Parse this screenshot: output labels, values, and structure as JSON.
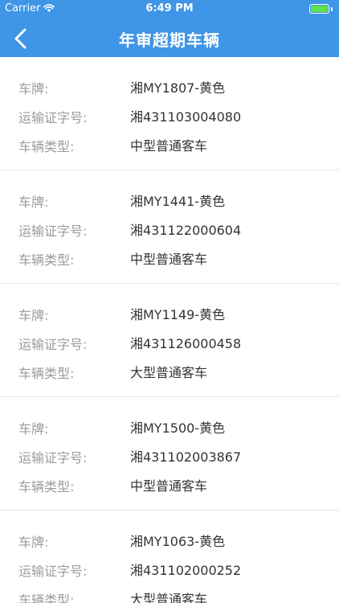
{
  "status_bar": {
    "carrier": "Carrier",
    "time": "6:49 PM",
    "battery_level_percent": 100
  },
  "nav": {
    "back_icon": "chevron-left-icon",
    "title": "年审超期车辆"
  },
  "labels": {
    "plate": "车牌:",
    "permit": "运输证字号:",
    "type": "车辆类型:"
  },
  "vehicles": [
    {
      "plate": "湘MY1807-黄色",
      "permit": "湘431103004080",
      "type": "中型普通客车"
    },
    {
      "plate": "湘MY1441-黄色",
      "permit": "湘431122000604",
      "type": "中型普通客车"
    },
    {
      "plate": "湘MY1149-黄色",
      "permit": "湘431126000458",
      "type": "大型普通客车"
    },
    {
      "plate": "湘MY1500-黄色",
      "permit": "湘431102003867",
      "type": "中型普通客车"
    },
    {
      "plate": "湘MY1063-黄色",
      "permit": "湘431102000252",
      "type": "大型普通客车"
    }
  ],
  "colors": {
    "nav_background": "#3f95e6",
    "label_text": "#9b9ba1",
    "value_text": "#333333",
    "battery_fill": "#5ee34a"
  }
}
